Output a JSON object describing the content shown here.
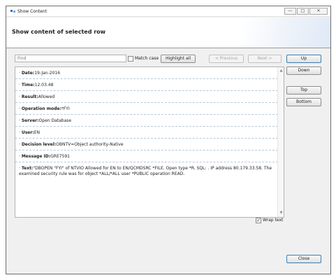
{
  "window": {
    "title": "Show Content",
    "buttons": {
      "minimize": "—",
      "maximize": "□",
      "close": "✕"
    }
  },
  "banner": {
    "title": "Show content of selected row"
  },
  "search": {
    "placeholder": "Find",
    "match_case_label": "Match case",
    "match_case_checked": false,
    "highlight_all": "Highlight all",
    "previous": "< Previous",
    "next": "Next >"
  },
  "nav_buttons": {
    "up": "Up",
    "down": "Down",
    "top": "Top",
    "bottom": "Bottom"
  },
  "rows": [
    {
      "key": "Date:",
      "value": "19-Jan-2016"
    },
    {
      "key": "Time:",
      "value": "12.03.48"
    },
    {
      "key": "Result:",
      "value": "Allowed"
    },
    {
      "key": "Operation mode:",
      "value": "*FYI"
    },
    {
      "key": "Server:",
      "value": "Open Database"
    },
    {
      "key": "User:",
      "value": "EN"
    },
    {
      "key": "Decision level:",
      "value": "OBNTV=Object authority-Native"
    },
    {
      "key": "Message ID:",
      "value": "GRE7591"
    },
    {
      "key": "Text:",
      "value": "\"DBOPEN \"FYI\" of NTVIO Allowed for EN to EN/QCMDSRC *FILE. Open type *R. SQL: . IP address 80.179.33.58. The examined security rule was for object *ALL/*ALL user *PUBLIC operation READ."
    }
  ],
  "wrap_text": {
    "label": "Wrap text",
    "checked": true
  },
  "close_button": "Close"
}
